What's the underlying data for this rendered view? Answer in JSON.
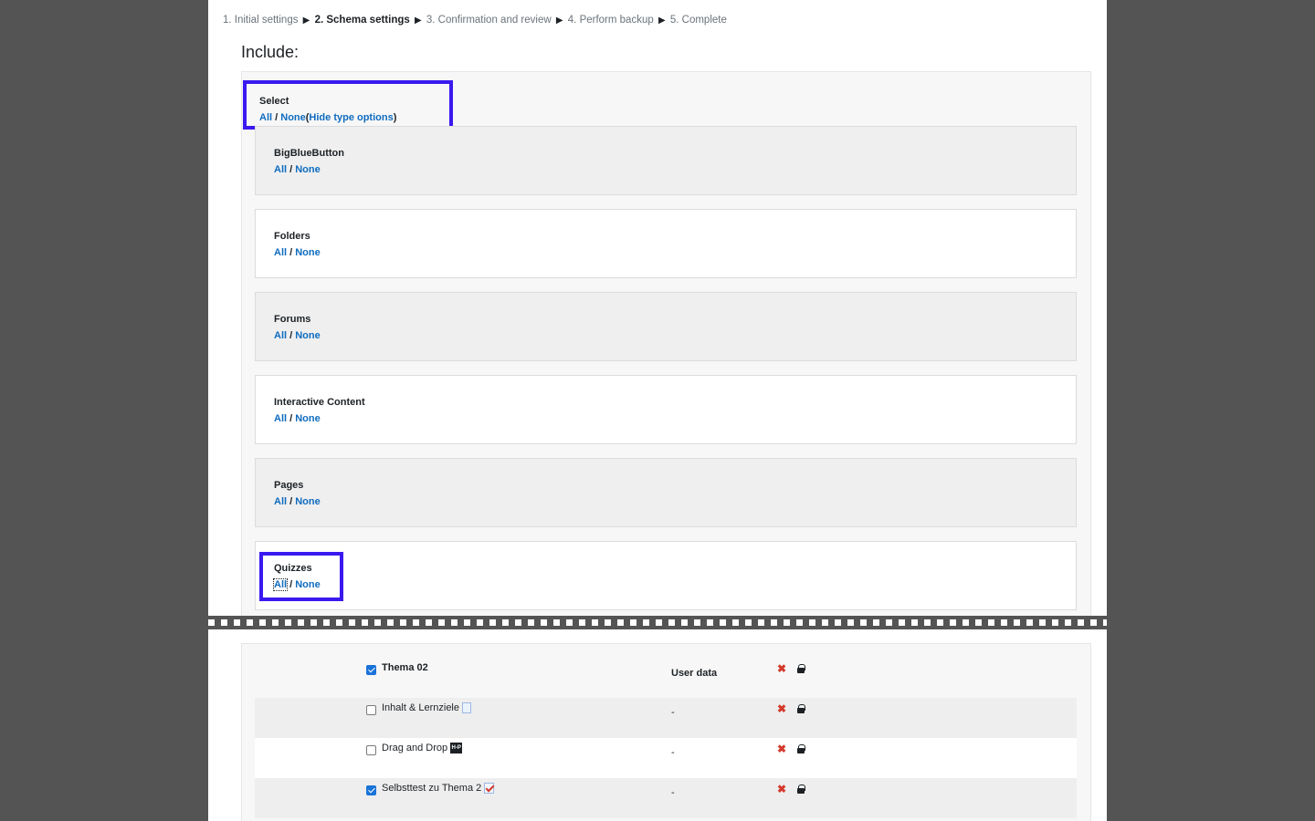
{
  "breadcrumb": {
    "steps": [
      "1. Initial settings",
      "2. Schema settings",
      "3. Confirmation and review",
      "4. Perform backup",
      "5. Complete"
    ],
    "separator": "▶",
    "current_index": 1
  },
  "heading": "Include:",
  "select": {
    "label": "Select",
    "all": "All",
    "slash": "/",
    "none": "None",
    "paren_open": "(",
    "toggle": "Hide type options",
    "paren_close": ")"
  },
  "types": [
    {
      "name": "BigBlueButton",
      "all": "All",
      "none": "None"
    },
    {
      "name": "Folders",
      "all": "All",
      "none": "None"
    },
    {
      "name": "Forums",
      "all": "All",
      "none": "None"
    },
    {
      "name": "Interactive Content",
      "all": "All",
      "none": "None"
    },
    {
      "name": "Pages",
      "all": "All",
      "none": "None"
    },
    {
      "name": "Quizzes",
      "all": "All",
      "none": "None"
    }
  ],
  "table": {
    "section": {
      "label": "Thema 02",
      "checked": true
    },
    "user_data_header": "User data",
    "items": [
      {
        "label": "Inhalt & Lernziele",
        "icon": "page-icon",
        "checked": false,
        "user_data": "-"
      },
      {
        "label": "Drag and Drop",
        "icon": "h5p-icon",
        "icon_text": "H-P",
        "checked": false,
        "user_data": "-"
      },
      {
        "label": "Selbsttest zu Thema 2",
        "icon": "quiz-icon",
        "checked": true,
        "user_data": "-"
      }
    ],
    "excluded_icon": "✖"
  },
  "colors": {
    "highlight": "#3a19f0",
    "link": "#0f6cbf",
    "excluded": "#d33a2c",
    "checkbox": "#1a73d9"
  }
}
